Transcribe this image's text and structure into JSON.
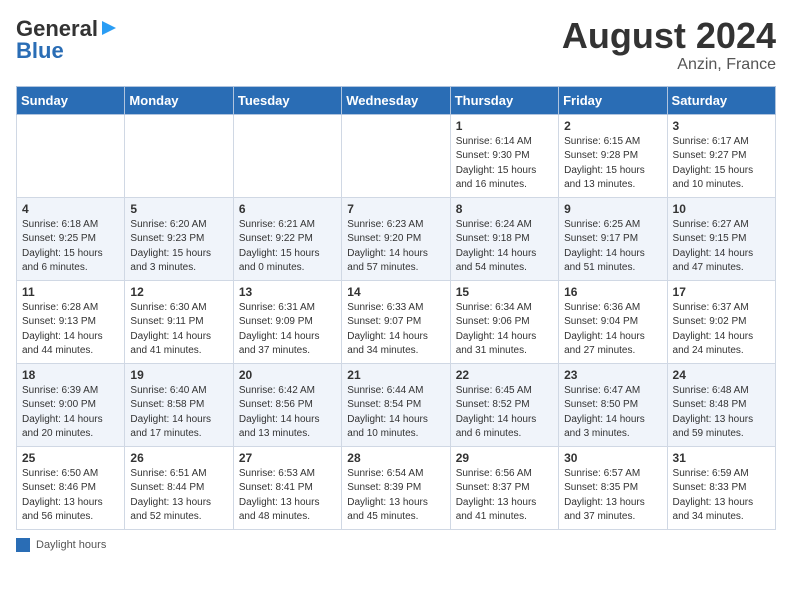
{
  "header": {
    "logo_general": "General",
    "logo_blue": "Blue",
    "month_title": "August 2024",
    "location": "Anzin, France"
  },
  "days_of_week": [
    "Sunday",
    "Monday",
    "Tuesday",
    "Wednesday",
    "Thursday",
    "Friday",
    "Saturday"
  ],
  "legend": {
    "label": "Daylight hours"
  },
  "weeks": [
    [
      {
        "num": "",
        "sunrise": "",
        "sunset": "",
        "daylight": ""
      },
      {
        "num": "",
        "sunrise": "",
        "sunset": "",
        "daylight": ""
      },
      {
        "num": "",
        "sunrise": "",
        "sunset": "",
        "daylight": ""
      },
      {
        "num": "",
        "sunrise": "",
        "sunset": "",
        "daylight": ""
      },
      {
        "num": "1",
        "sunrise": "Sunrise: 6:14 AM",
        "sunset": "Sunset: 9:30 PM",
        "daylight": "Daylight: 15 hours and 16 minutes."
      },
      {
        "num": "2",
        "sunrise": "Sunrise: 6:15 AM",
        "sunset": "Sunset: 9:28 PM",
        "daylight": "Daylight: 15 hours and 13 minutes."
      },
      {
        "num": "3",
        "sunrise": "Sunrise: 6:17 AM",
        "sunset": "Sunset: 9:27 PM",
        "daylight": "Daylight: 15 hours and 10 minutes."
      }
    ],
    [
      {
        "num": "4",
        "sunrise": "Sunrise: 6:18 AM",
        "sunset": "Sunset: 9:25 PM",
        "daylight": "Daylight: 15 hours and 6 minutes."
      },
      {
        "num": "5",
        "sunrise": "Sunrise: 6:20 AM",
        "sunset": "Sunset: 9:23 PM",
        "daylight": "Daylight: 15 hours and 3 minutes."
      },
      {
        "num": "6",
        "sunrise": "Sunrise: 6:21 AM",
        "sunset": "Sunset: 9:22 PM",
        "daylight": "Daylight: 15 hours and 0 minutes."
      },
      {
        "num": "7",
        "sunrise": "Sunrise: 6:23 AM",
        "sunset": "Sunset: 9:20 PM",
        "daylight": "Daylight: 14 hours and 57 minutes."
      },
      {
        "num": "8",
        "sunrise": "Sunrise: 6:24 AM",
        "sunset": "Sunset: 9:18 PM",
        "daylight": "Daylight: 14 hours and 54 minutes."
      },
      {
        "num": "9",
        "sunrise": "Sunrise: 6:25 AM",
        "sunset": "Sunset: 9:17 PM",
        "daylight": "Daylight: 14 hours and 51 minutes."
      },
      {
        "num": "10",
        "sunrise": "Sunrise: 6:27 AM",
        "sunset": "Sunset: 9:15 PM",
        "daylight": "Daylight: 14 hours and 47 minutes."
      }
    ],
    [
      {
        "num": "11",
        "sunrise": "Sunrise: 6:28 AM",
        "sunset": "Sunset: 9:13 PM",
        "daylight": "Daylight: 14 hours and 44 minutes."
      },
      {
        "num": "12",
        "sunrise": "Sunrise: 6:30 AM",
        "sunset": "Sunset: 9:11 PM",
        "daylight": "Daylight: 14 hours and 41 minutes."
      },
      {
        "num": "13",
        "sunrise": "Sunrise: 6:31 AM",
        "sunset": "Sunset: 9:09 PM",
        "daylight": "Daylight: 14 hours and 37 minutes."
      },
      {
        "num": "14",
        "sunrise": "Sunrise: 6:33 AM",
        "sunset": "Sunset: 9:07 PM",
        "daylight": "Daylight: 14 hours and 34 minutes."
      },
      {
        "num": "15",
        "sunrise": "Sunrise: 6:34 AM",
        "sunset": "Sunset: 9:06 PM",
        "daylight": "Daylight: 14 hours and 31 minutes."
      },
      {
        "num": "16",
        "sunrise": "Sunrise: 6:36 AM",
        "sunset": "Sunset: 9:04 PM",
        "daylight": "Daylight: 14 hours and 27 minutes."
      },
      {
        "num": "17",
        "sunrise": "Sunrise: 6:37 AM",
        "sunset": "Sunset: 9:02 PM",
        "daylight": "Daylight: 14 hours and 24 minutes."
      }
    ],
    [
      {
        "num": "18",
        "sunrise": "Sunrise: 6:39 AM",
        "sunset": "Sunset: 9:00 PM",
        "daylight": "Daylight: 14 hours and 20 minutes."
      },
      {
        "num": "19",
        "sunrise": "Sunrise: 6:40 AM",
        "sunset": "Sunset: 8:58 PM",
        "daylight": "Daylight: 14 hours and 17 minutes."
      },
      {
        "num": "20",
        "sunrise": "Sunrise: 6:42 AM",
        "sunset": "Sunset: 8:56 PM",
        "daylight": "Daylight: 14 hours and 13 minutes."
      },
      {
        "num": "21",
        "sunrise": "Sunrise: 6:44 AM",
        "sunset": "Sunset: 8:54 PM",
        "daylight": "Daylight: 14 hours and 10 minutes."
      },
      {
        "num": "22",
        "sunrise": "Sunrise: 6:45 AM",
        "sunset": "Sunset: 8:52 PM",
        "daylight": "Daylight: 14 hours and 6 minutes."
      },
      {
        "num": "23",
        "sunrise": "Sunrise: 6:47 AM",
        "sunset": "Sunset: 8:50 PM",
        "daylight": "Daylight: 14 hours and 3 minutes."
      },
      {
        "num": "24",
        "sunrise": "Sunrise: 6:48 AM",
        "sunset": "Sunset: 8:48 PM",
        "daylight": "Daylight: 13 hours and 59 minutes."
      }
    ],
    [
      {
        "num": "25",
        "sunrise": "Sunrise: 6:50 AM",
        "sunset": "Sunset: 8:46 PM",
        "daylight": "Daylight: 13 hours and 56 minutes."
      },
      {
        "num": "26",
        "sunrise": "Sunrise: 6:51 AM",
        "sunset": "Sunset: 8:44 PM",
        "daylight": "Daylight: 13 hours and 52 minutes."
      },
      {
        "num": "27",
        "sunrise": "Sunrise: 6:53 AM",
        "sunset": "Sunset: 8:41 PM",
        "daylight": "Daylight: 13 hours and 48 minutes."
      },
      {
        "num": "28",
        "sunrise": "Sunrise: 6:54 AM",
        "sunset": "Sunset: 8:39 PM",
        "daylight": "Daylight: 13 hours and 45 minutes."
      },
      {
        "num": "29",
        "sunrise": "Sunrise: 6:56 AM",
        "sunset": "Sunset: 8:37 PM",
        "daylight": "Daylight: 13 hours and 41 minutes."
      },
      {
        "num": "30",
        "sunrise": "Sunrise: 6:57 AM",
        "sunset": "Sunset: 8:35 PM",
        "daylight": "Daylight: 13 hours and 37 minutes."
      },
      {
        "num": "31",
        "sunrise": "Sunrise: 6:59 AM",
        "sunset": "Sunset: 8:33 PM",
        "daylight": "Daylight: 13 hours and 34 minutes."
      }
    ]
  ]
}
